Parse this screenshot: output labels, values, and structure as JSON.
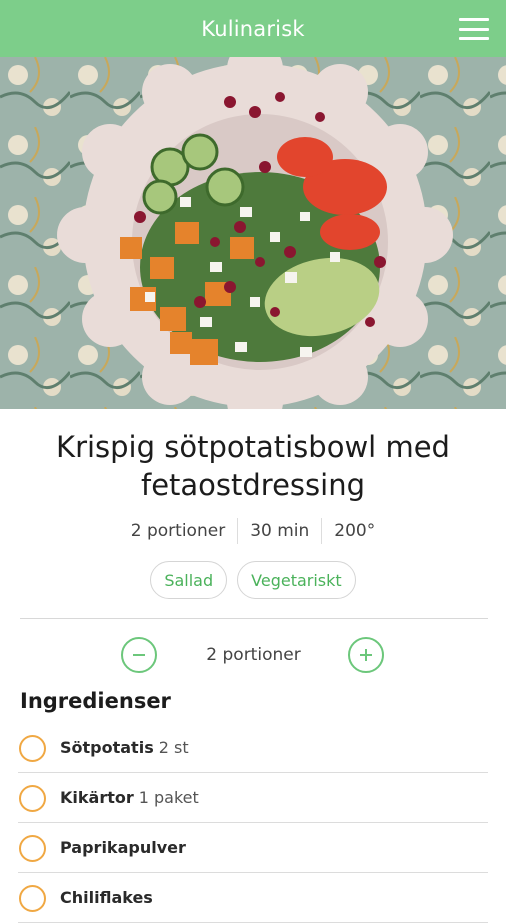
{
  "app": {
    "title": "Kulinarisk"
  },
  "recipe": {
    "title": "Krispig sötpotatisbowl med fetaostdressing",
    "portions": "2 portioner",
    "time": "30 min",
    "temperature": "200°"
  },
  "tags": [
    "Sallad",
    "Vegetariskt"
  ],
  "portion_control": {
    "label": "2 portioner"
  },
  "ingredients": {
    "heading": "Ingredienser",
    "items": [
      {
        "name": "Sötpotatis",
        "amount": "2 st"
      },
      {
        "name": "Kikärtor",
        "amount": "1 paket"
      },
      {
        "name": "Paprikapulver",
        "amount": ""
      },
      {
        "name": "Chiliflakes",
        "amount": ""
      }
    ]
  },
  "colors": {
    "header_green": "#7dce8a",
    "tag_green": "#4bb25b",
    "checkbox_orange": "#f0a843"
  },
  "icons": {
    "menu": "hamburger-menu-icon",
    "decrease": "minus-circle-icon",
    "increase": "plus-circle-icon",
    "checkbox": "empty-circle-checkbox-icon"
  }
}
